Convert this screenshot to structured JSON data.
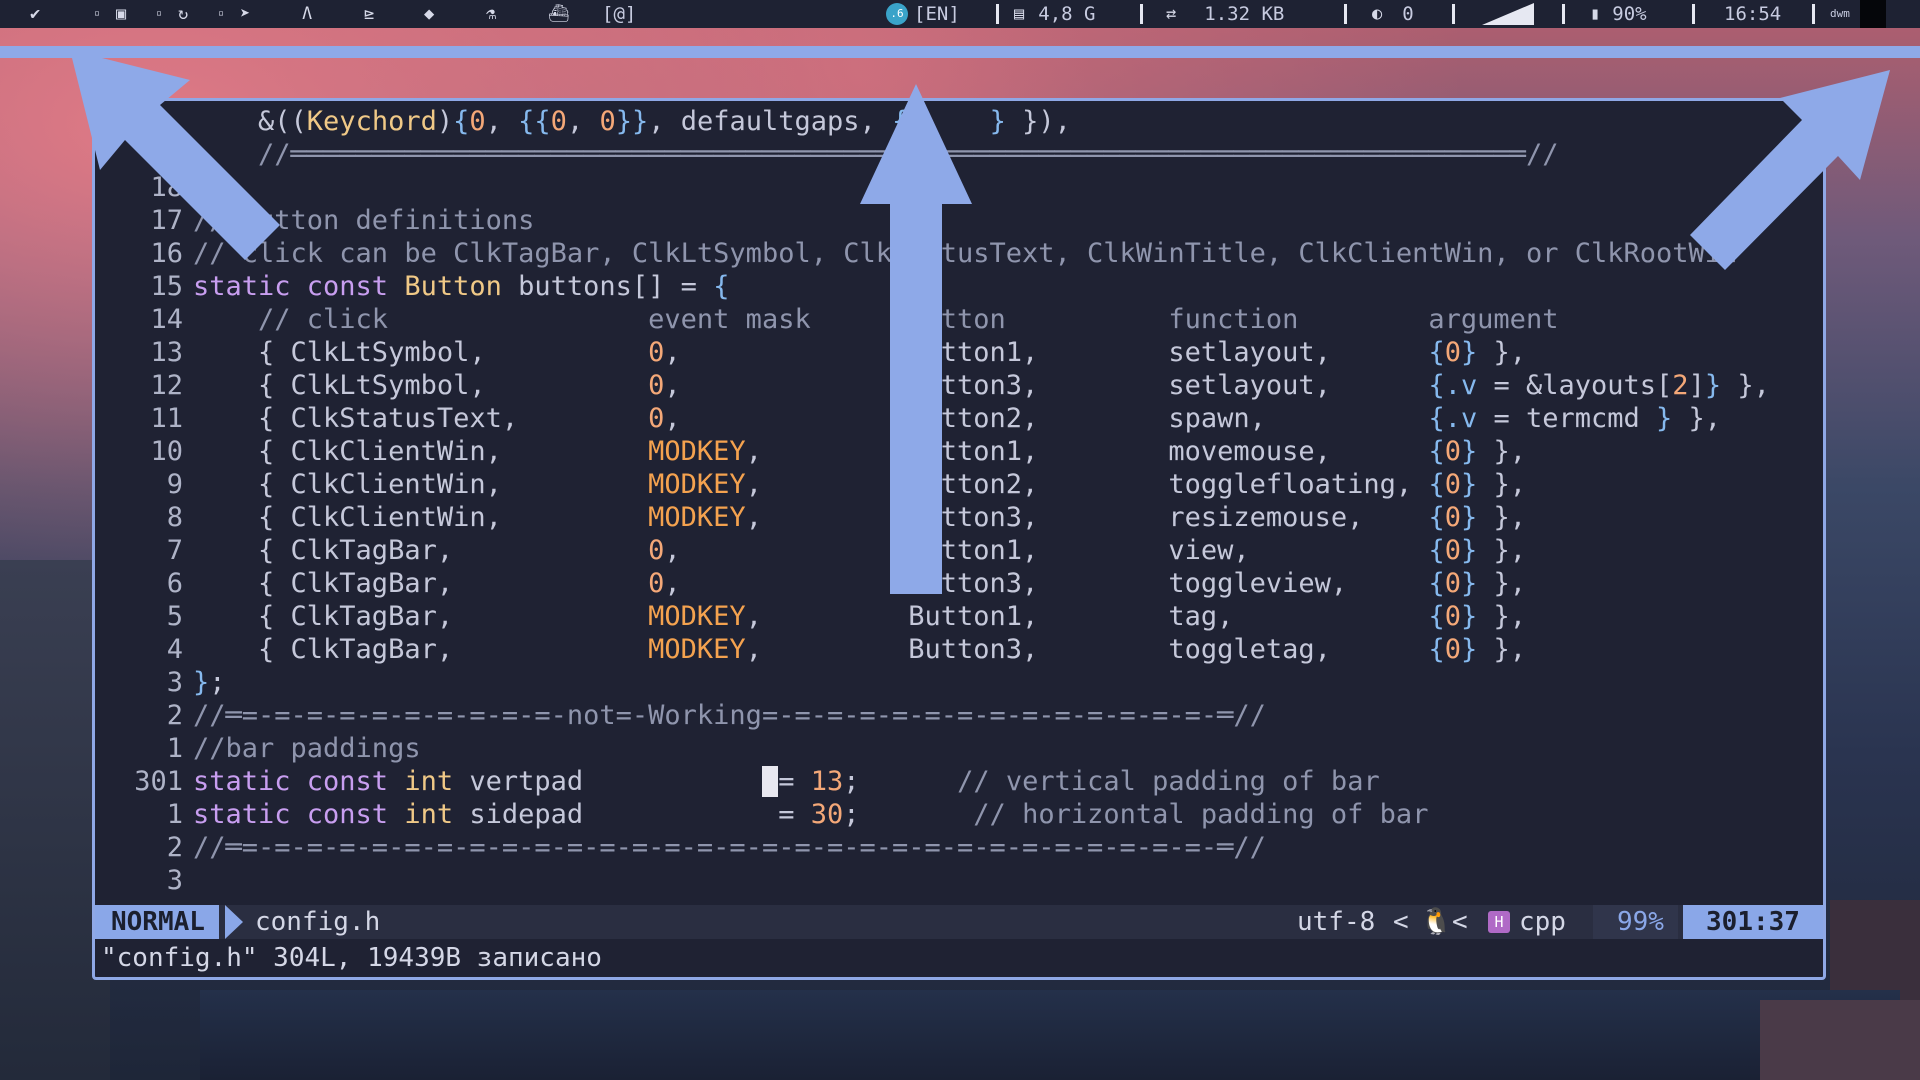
{
  "topbar": {
    "workspace_icons": [
      "check-icon",
      "terminal-icon",
      "square-icon",
      "refresh-icon",
      "telegram-icon",
      "font-icon",
      "chart-icon",
      "diamond-icon",
      "flask-icon",
      "docker-icon"
    ],
    "workspace_text": "[@]",
    "lang": "[EN]",
    "lang_badge": ".6",
    "ram": "4,8 G",
    "net": "1.32 KB",
    "moon_count": "0",
    "battery": "90%",
    "time": "16:54",
    "layout": "dwm"
  },
  "editor": {
    "lines": [
      {
        "ln": "",
        "segs": [
          [
            "pun",
            "    &(("
          ],
          [
            "ty",
            "Keychord"
          ],
          [
            "pun",
            ")"
          ],
          [
            "br",
            "{"
          ],
          [
            "num",
            "0"
          ],
          [
            "pun",
            ", "
          ],
          [
            "br",
            "{{"
          ],
          [
            "num",
            "0"
          ],
          [
            "pun",
            ", "
          ],
          [
            "num",
            "0"
          ],
          [
            "br",
            "}}"
          ],
          [
            "pun",
            ", defaultgaps, "
          ],
          [
            "br",
            "{"
          ],
          [
            "pun",
            "     "
          ],
          [
            "br",
            "}"
          ],
          [
            "pun",
            " }),"
          ]
        ]
      },
      {
        "ln": "1",
        "segs": [
          [
            "cm",
            "    //════════════════════════════════════════════════════════════════════════════//"
          ]
        ]
      },
      {
        "ln": "18",
        "segs": [
          [
            "pun",
            ""
          ]
        ]
      },
      {
        "ln": "17",
        "segs": [
          [
            "cm",
            "// button definitions"
          ]
        ]
      },
      {
        "ln": "16",
        "segs": [
          [
            "cm",
            "// click can be ClkTagBar, ClkLtSymbol, ClkStatusText, ClkWinTitle, ClkClientWin, or ClkRootWin"
          ]
        ]
      },
      {
        "ln": "15",
        "segs": [
          [
            "kw",
            "static const "
          ],
          [
            "ty",
            "Button"
          ],
          [
            "pun",
            " buttons[] = "
          ],
          [
            "br",
            "{"
          ]
        ]
      },
      {
        "ln": "14",
        "segs": [
          [
            "cm",
            "    // click                event mask      button          function        argument"
          ]
        ]
      },
      {
        "ln": "13",
        "segs": [
          [
            "pun",
            "    { ClkLtSymbol,          "
          ],
          [
            "num",
            "0"
          ],
          [
            "pun",
            ",              Button1,        setlayout,      "
          ],
          [
            "br",
            "{"
          ],
          [
            "num",
            "0"
          ],
          [
            "br",
            "}"
          ],
          [
            "pun",
            " },"
          ]
        ]
      },
      {
        "ln": "12",
        "segs": [
          [
            "pun",
            "    { ClkLtSymbol,          "
          ],
          [
            "num",
            "0"
          ],
          [
            "pun",
            ",              Button3,        setlayout,      "
          ],
          [
            "br",
            "{.v"
          ],
          [
            "pun",
            " = &layouts["
          ],
          [
            "num",
            "2"
          ],
          [
            "pun",
            "]"
          ],
          [
            "br",
            "}"
          ],
          [
            "pun",
            " },"
          ]
        ]
      },
      {
        "ln": "11",
        "segs": [
          [
            "pun",
            "    { ClkStatusText,        "
          ],
          [
            "num",
            "0"
          ],
          [
            "pun",
            ",              Button2,        spawn,          "
          ],
          [
            "br",
            "{.v"
          ],
          [
            "pun",
            " = termcmd "
          ],
          [
            "br",
            "}"
          ],
          [
            "pun",
            " },"
          ]
        ]
      },
      {
        "ln": "10",
        "segs": [
          [
            "pun",
            "    { ClkClientWin,         "
          ],
          [
            "mod",
            "MODKEY"
          ],
          [
            "pun",
            ",         Button1,        movemouse,      "
          ],
          [
            "br",
            "{"
          ],
          [
            "num",
            "0"
          ],
          [
            "br",
            "}"
          ],
          [
            "pun",
            " },"
          ]
        ]
      },
      {
        "ln": "9",
        "segs": [
          [
            "pun",
            "    { ClkClientWin,         "
          ],
          [
            "mod",
            "MODKEY"
          ],
          [
            "pun",
            ",         Button2,        togglefloating, "
          ],
          [
            "br",
            "{"
          ],
          [
            "num",
            "0"
          ],
          [
            "br",
            "}"
          ],
          [
            "pun",
            " },"
          ]
        ]
      },
      {
        "ln": "8",
        "segs": [
          [
            "pun",
            "    { ClkClientWin,         "
          ],
          [
            "mod",
            "MODKEY"
          ],
          [
            "pun",
            ",         Button3,        resizemouse,    "
          ],
          [
            "br",
            "{"
          ],
          [
            "num",
            "0"
          ],
          [
            "br",
            "}"
          ],
          [
            "pun",
            " },"
          ]
        ]
      },
      {
        "ln": "7",
        "segs": [
          [
            "pun",
            "    { ClkTagBar,            "
          ],
          [
            "num",
            "0"
          ],
          [
            "pun",
            ",              Button1,        view,           "
          ],
          [
            "br",
            "{"
          ],
          [
            "num",
            "0"
          ],
          [
            "br",
            "}"
          ],
          [
            "pun",
            " },"
          ]
        ]
      },
      {
        "ln": "6",
        "segs": [
          [
            "pun",
            "    { ClkTagBar,            "
          ],
          [
            "num",
            "0"
          ],
          [
            "pun",
            ",              Button3,        toggleview,     "
          ],
          [
            "br",
            "{"
          ],
          [
            "num",
            "0"
          ],
          [
            "br",
            "}"
          ],
          [
            "pun",
            " },"
          ]
        ]
      },
      {
        "ln": "5",
        "segs": [
          [
            "pun",
            "    { ClkTagBar,            "
          ],
          [
            "mod",
            "MODKEY"
          ],
          [
            "pun",
            ",         Button1,        tag,            "
          ],
          [
            "br",
            "{"
          ],
          [
            "num",
            "0"
          ],
          [
            "br",
            "}"
          ],
          [
            "pun",
            " },"
          ]
        ]
      },
      {
        "ln": "4",
        "segs": [
          [
            "pun",
            "    { ClkTagBar,            "
          ],
          [
            "mod",
            "MODKEY"
          ],
          [
            "pun",
            ",         Button3,        toggletag,      "
          ],
          [
            "br",
            "{"
          ],
          [
            "num",
            "0"
          ],
          [
            "br",
            "}"
          ],
          [
            "pun",
            " },"
          ]
        ]
      },
      {
        "ln": "3",
        "segs": [
          [
            "br",
            "}"
          ],
          [
            "pun",
            ";"
          ]
        ]
      },
      {
        "ln": "2",
        "segs": [
          [
            "cm",
            "//═=-=-=-=-=-=-=-=-=-=-not=-Working=-=-=-=-=-=-=-=-=-=-=-=-=-=-═//"
          ]
        ]
      },
      {
        "ln": "1",
        "segs": [
          [
            "cm",
            "//bar paddings"
          ]
        ]
      },
      {
        "ln": "301",
        "segs": [
          [
            "kw",
            "static const "
          ],
          [
            "ty",
            "int"
          ],
          [
            "pun",
            " vertpad           "
          ],
          [
            "cursor",
            " "
          ],
          [
            "pun",
            "= "
          ],
          [
            "num",
            "13"
          ],
          [
            "pun",
            ";      "
          ],
          [
            "cm",
            "// vertical padding of bar"
          ]
        ]
      },
      {
        "ln": "1",
        "segs": [
          [
            "kw",
            "static const "
          ],
          [
            "ty",
            "int"
          ],
          [
            "pun",
            " sidepad            = "
          ],
          [
            "num",
            "30"
          ],
          [
            "pun",
            ";       "
          ],
          [
            "cm",
            "// horizontal padding of bar"
          ]
        ]
      },
      {
        "ln": "2",
        "segs": [
          [
            "cm",
            "//═=-=-=-=-=-=-=-=-=-=-=-=-=-=-=-=-=-=-=-=-=-=-=-=-=-=-=-=-=-=-═//"
          ]
        ]
      },
      {
        "ln": "3",
        "segs": [
          [
            "pun",
            ""
          ]
        ]
      }
    ]
  },
  "statusline": {
    "mode": "NORMAL",
    "filename": "config.h",
    "encoding": "utf-8",
    "sep": "<",
    "os_icon": "🐧",
    "ft_icon": "H",
    "filetype": "cpp",
    "percent": "99%",
    "position": "301:37"
  },
  "message": "\"config.h\" 304L, 19439B записано",
  "colors": {
    "accent": "#8aa7e8",
    "editor_bg": "#1f2233"
  }
}
